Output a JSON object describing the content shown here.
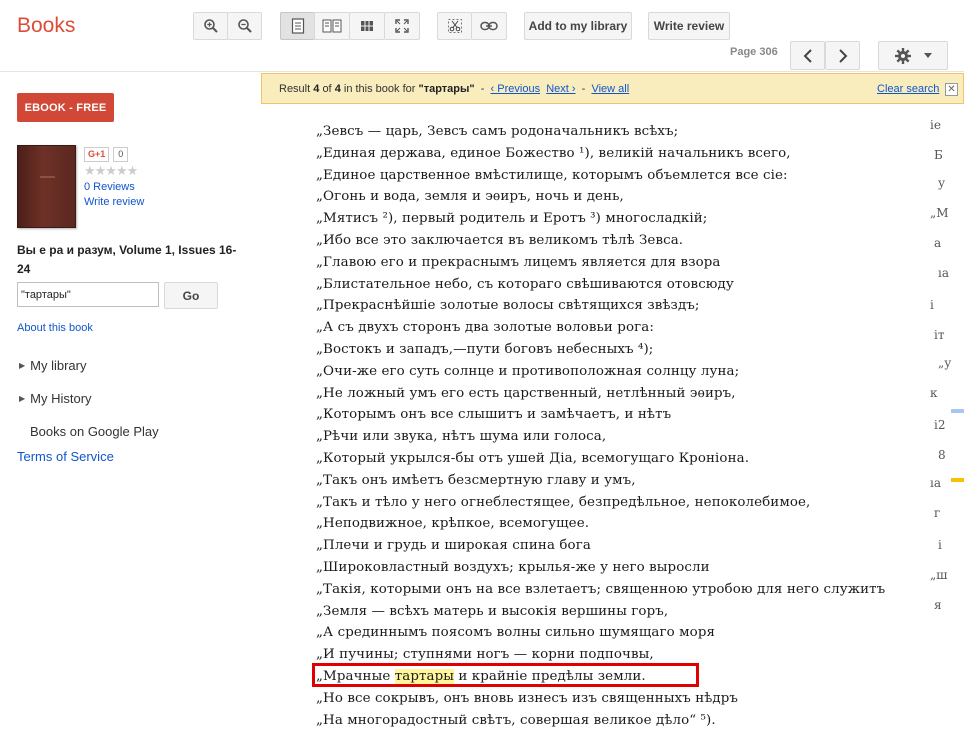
{
  "app": {
    "brand": "Books"
  },
  "toolbar": {
    "add_library": "Add to my library",
    "write_review": "Write review",
    "page_label": "Page 306"
  },
  "left": {
    "ebook_label": "EBOOK - FREE",
    "gplus_label": "G+1",
    "gplus_count": "0",
    "reviews_label": "0 Reviews",
    "write_review_label": "Write review",
    "book_title": "Вы е ра и разум, Volume 1, Issues 16-24",
    "search_value": "\"тартары\"",
    "go_label": "Go",
    "about_label": "About this book",
    "my_library": "My library",
    "my_history": "My History",
    "google_play": "Books on Google Play",
    "terms": "Terms of Service"
  },
  "result_bar": {
    "prefix": "Result",
    "index": "4",
    "of": "of",
    "total": "4",
    "mid": "in this book for",
    "query": "\"тартары\"",
    "sep": "-",
    "previous": "‹ Previous",
    "next": "Next ›",
    "view_all": "View all",
    "clear": "Clear search",
    "close": "✕"
  },
  "page_text": {
    "lines": [
      "„Зевсъ — царь, Зевсъ самъ родоначальникъ всѣхъ;",
      "„Единая держава, единое Божество ¹), великій начальникъ всего,",
      "„Единое царственное вмѣстилище, которымъ объемлется все сіе:",
      "„Огонь и вода, земля и эѳиръ, ночь и день,",
      "„Мятисъ ²), первый родитель и Еротъ ³) многосладкій;",
      "„Ибо все это заключается въ великомъ тѣлѣ Зевса.",
      "„Главою его и прекраснымъ лицемъ является для взора",
      "„Блистательное небо, съ котораго свѣшиваются отовсюду",
      "„Прекраснѣйшіе золотые волосы свѣтящихся звѣздъ;",
      "„А съ двухъ сторонъ два золотые воловьи рога:",
      "„Востокъ и западъ,—пути боговъ небесныхъ ⁴);",
      "„Очи-же его суть солнце и противоположная солнцу луна;",
      "„Не ложный умъ его есть царственный, нетлѣнный эѳиръ,",
      "„Которымъ онъ все слышитъ и замѣчаетъ, и нѣтъ",
      "„Рѣчи или звука, нѣтъ шума или голоса,",
      "„Который укрылся-бы отъ ушей Діа, всемогущаго Кроніона.",
      "„Такъ онъ имѣетъ безсмертную главу и умъ,",
      "„Такъ и тѣло у него огнеблестящее, безпредѣльное, непоколебимое,",
      "„Неподвижное, крѣпкое, всемогущее.",
      "„Плечи и грудь и широкая спина бога",
      "„Широковластный воздухъ; крылья-же у него выросли",
      "„Такія, которыми онъ на все взлетаетъ; священною утробою для него служитъ",
      "„Земля — всѣхъ матерь и высокія вершины горъ,",
      "„А срединнымъ поясомъ волны сильно шумящаго моря",
      "„И пучины; ступнями ногъ — корни подпочвы,",
      "",
      "„Но все сокрывъ, онъ вновь изнесъ изъ священныхъ нѣдръ",
      "„На многорадостный свѣтъ, совершая великое дѣло“ ⁵)."
    ],
    "highlight_line": {
      "before": "„Мрачные ",
      "match": "тартары",
      "after": " и крайніе предѣлы земли."
    }
  },
  "margin_text": [
    "іе",
    "Б",
    "у",
    "„М",
    "а",
    "ıа",
    "і",
    "іт",
    "„у",
    "к",
    "і2",
    "8",
    "ıа",
    "г",
    "і",
    "„ш",
    "я"
  ],
  "colors": {
    "brand": "#dd4b39",
    "highlight": "#fff59a",
    "annotation": "#e10000"
  },
  "icons": [
    "zoom-in-icon",
    "zoom-out-icon",
    "page-view-icon",
    "two-page-view-icon",
    "thumbnail-view-icon",
    "fullscreen-icon",
    "clip-icon",
    "link-icon",
    "prev-page-icon",
    "next-page-icon",
    "settings-gear-icon"
  ]
}
